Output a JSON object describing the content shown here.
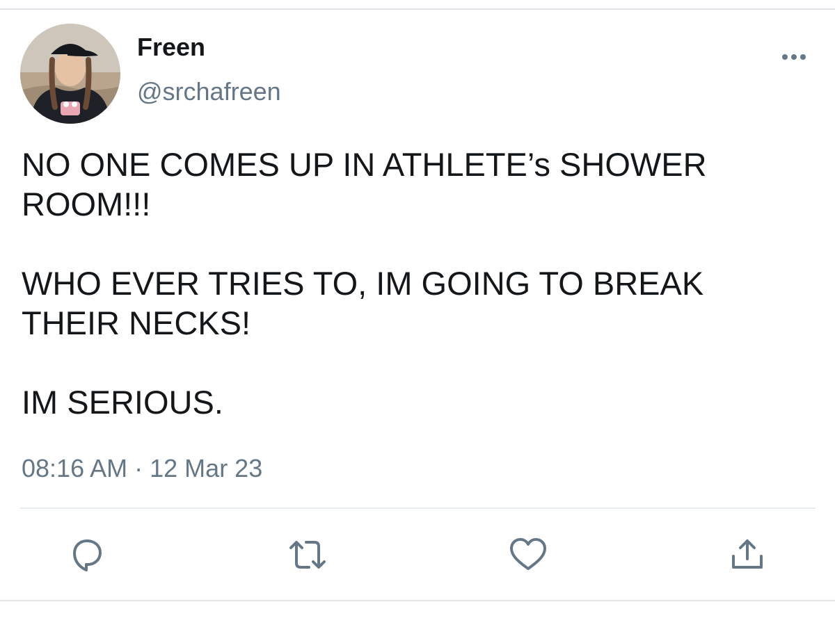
{
  "tweet": {
    "author": {
      "display_name": "Freen",
      "handle": "@srchafreen"
    },
    "text": "NO ONE COMES UP IN ATHLETE’s SHOWER\nROOM!!!\n\nWHO EVER TRIES TO, IM GOING TO BREAK\nTHEIR NECKS!\n\nIM SERIOUS.",
    "time": "08:16 AM",
    "separator": "·",
    "date": "12 Mar 23"
  },
  "icons": {
    "more": "more-dots-icon",
    "reply": "reply-bubble-icon",
    "retweet": "retweet-arrows-icon",
    "like": "heart-icon",
    "share": "share-upload-icon"
  },
  "colors": {
    "text": "#14171a",
    "secondary": "#657786",
    "icon": "#657786",
    "divider": "#e6ecf0"
  }
}
